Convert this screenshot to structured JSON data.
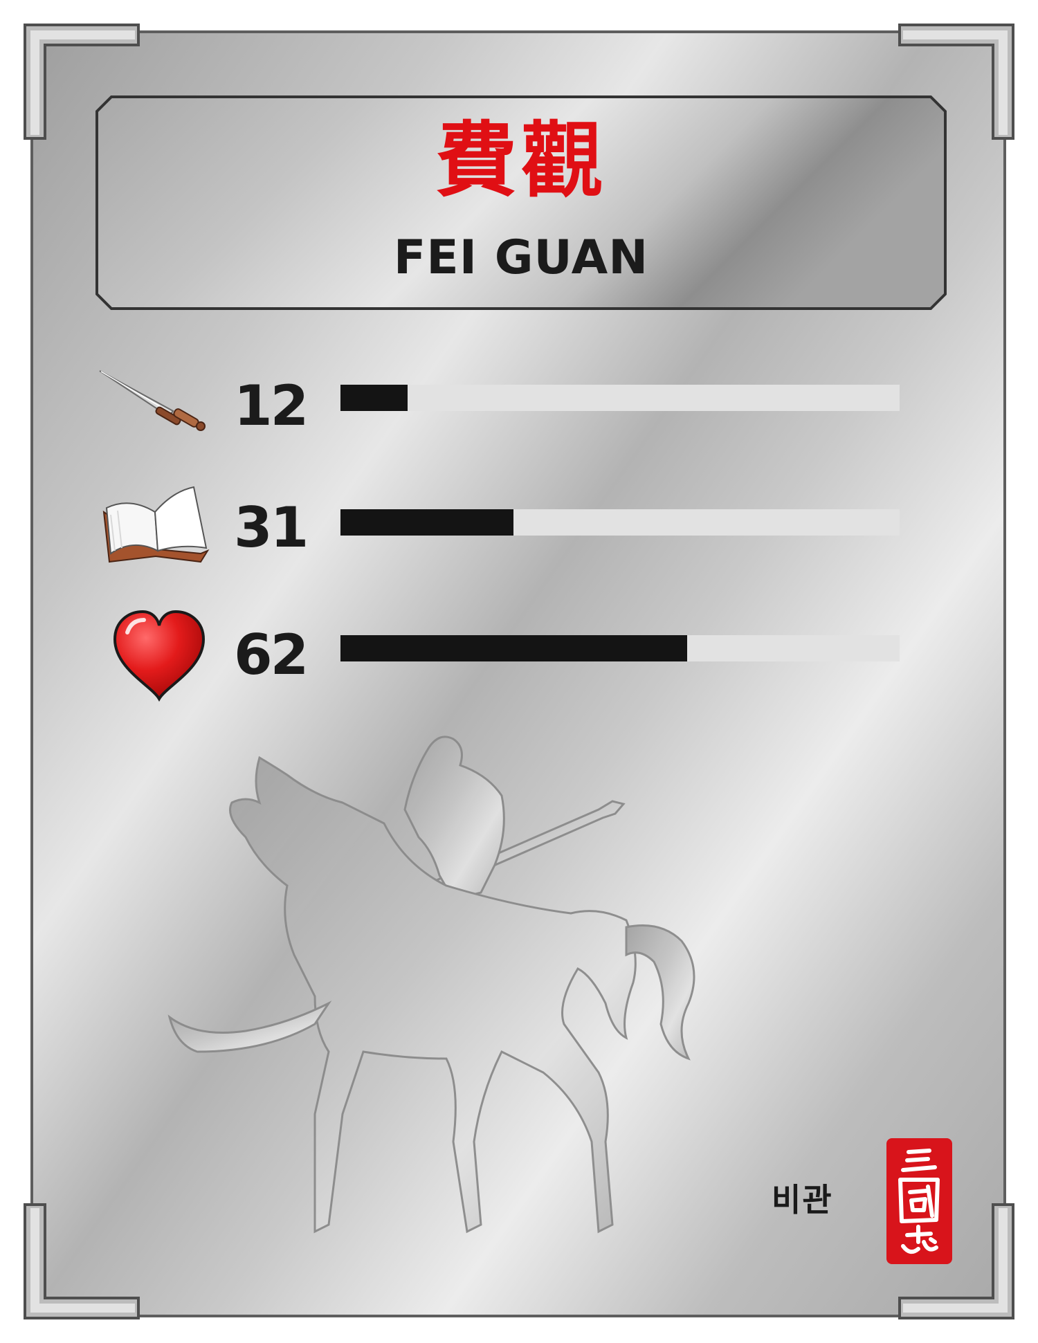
{
  "card": {
    "name_chinese": "費觀",
    "name_english": "FEI GUAN",
    "name_korean": "비관",
    "seal_text": "三國志"
  },
  "stats": [
    {
      "icon": "sword-icon",
      "label": "12",
      "value": 12,
      "fill": 0.12
    },
    {
      "icon": "book-icon",
      "label": "31",
      "value": 31,
      "fill": 0.31
    },
    {
      "icon": "heart-icon",
      "label": "62",
      "value": 62,
      "fill": 0.62
    }
  ],
  "colors": {
    "title_red": "#e00f14",
    "text_dark": "#1b1b1b",
    "bar_fill": "#141414",
    "bar_track": "#e2e2e2",
    "seal_red": "#d8141b",
    "heart_red": "#e31b1b"
  },
  "artwork": "mounted-warrior-silhouette"
}
